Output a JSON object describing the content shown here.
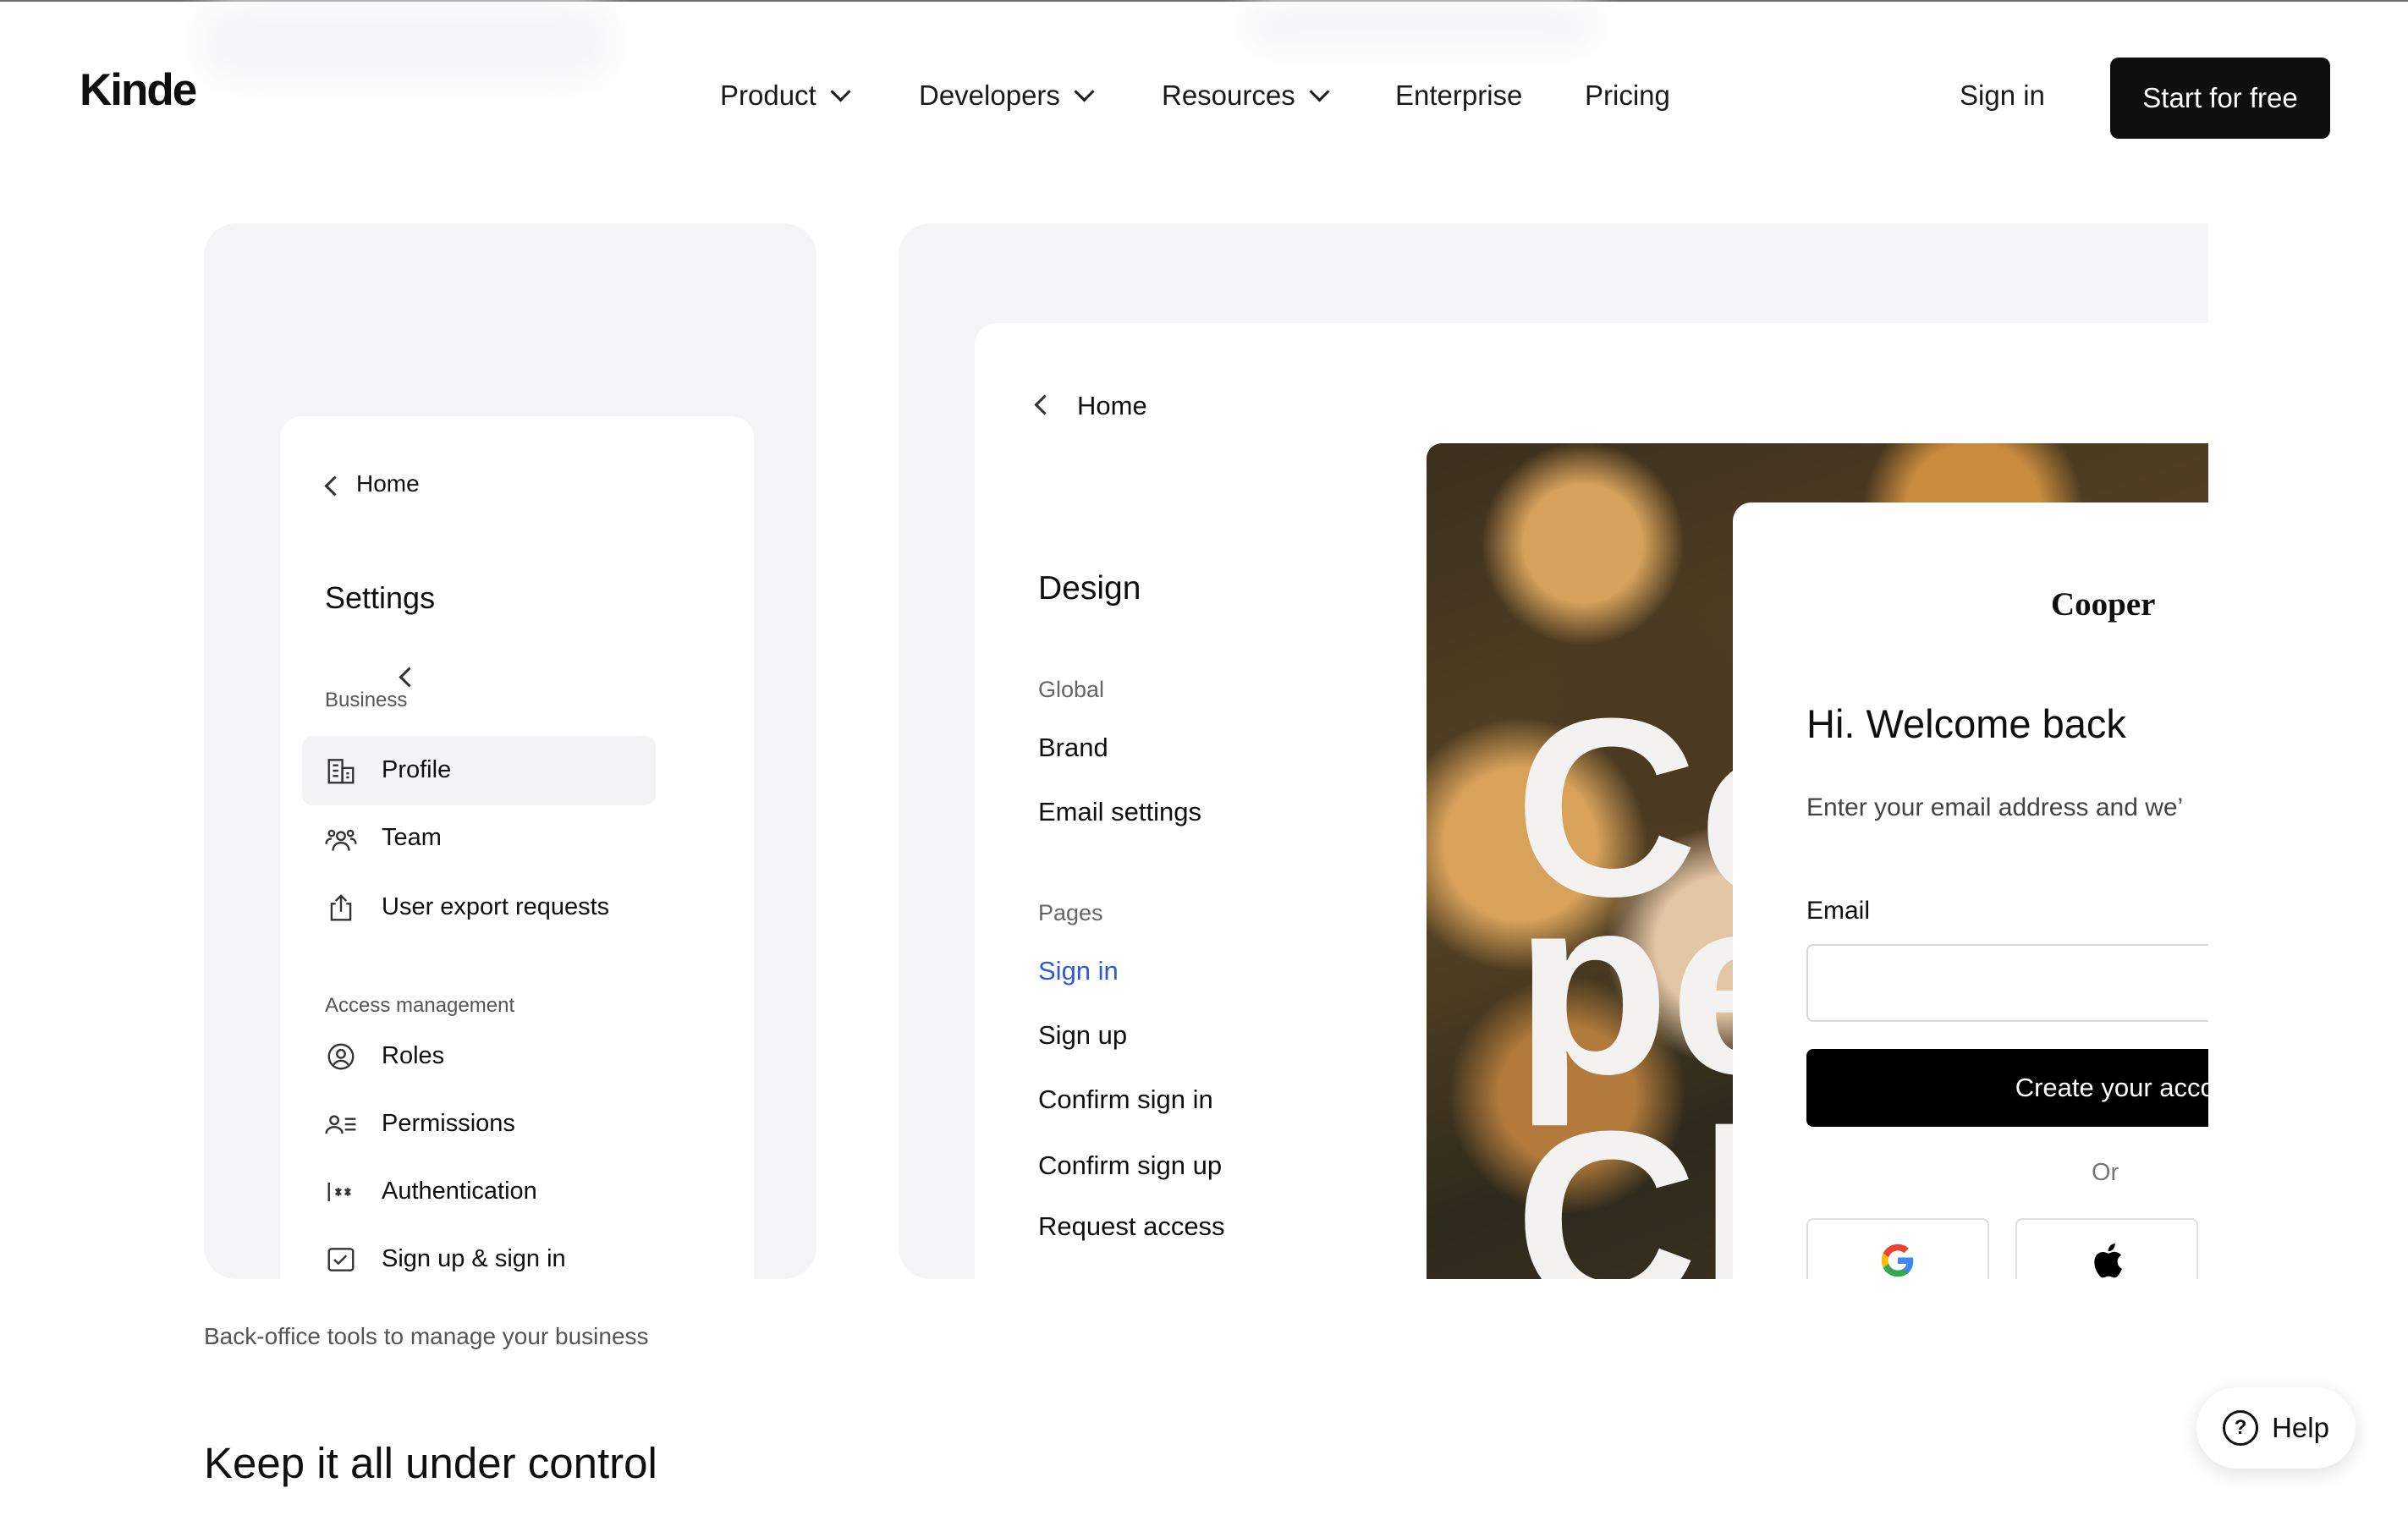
{
  "header": {
    "logo": "Kinde",
    "nav": [
      {
        "label": "Product",
        "dropdown": true
      },
      {
        "label": "Developers",
        "dropdown": true
      },
      {
        "label": "Resources",
        "dropdown": true
      },
      {
        "label": "Enterprise",
        "dropdown": false
      },
      {
        "label": "Pricing",
        "dropdown": false
      }
    ],
    "sign_in": "Sign in",
    "cta": "Start for free"
  },
  "settings_card": {
    "back": "Home",
    "title": "Settings",
    "sections": [
      {
        "heading": "Business",
        "items": [
          {
            "label": "Profile",
            "icon": "building-icon",
            "selected": true
          },
          {
            "label": "Team",
            "icon": "team-icon"
          },
          {
            "label": "User export requests",
            "icon": "export-icon"
          }
        ]
      },
      {
        "heading": "Access management",
        "items": [
          {
            "label": "Roles",
            "icon": "user-circle-icon"
          },
          {
            "label": "Permissions",
            "icon": "user-list-icon"
          },
          {
            "label": "Authentication",
            "icon": "password-icon"
          },
          {
            "label": "Sign up & sign in",
            "icon": "checkbox-icon"
          }
        ]
      }
    ],
    "caption": "Back-office tools to manage your business"
  },
  "design_card": {
    "back": "Home",
    "title": "Design",
    "global_heading": "Global",
    "global_items": [
      "Brand",
      "Email settings"
    ],
    "pages_heading": "Pages",
    "pages_items": [
      "Sign in",
      "Sign up",
      "Confirm sign in",
      "Confirm sign up",
      "Request access"
    ],
    "active_page": "Sign in",
    "preview": {
      "brand": "Cooper",
      "welcome": "Hi. Welcome back",
      "subtitle": "Enter your email address and we’",
      "email_label": "Email",
      "email_value": "",
      "create_button": "Create your accou",
      "or": "Or",
      "image_letters": [
        "Co",
        "pe",
        "Cl"
      ]
    }
  },
  "section_heading": "Keep it all under control",
  "help": "Help",
  "colors": {
    "accent_link": "#2d5ad8",
    "cta_bg": "#0f0f0f",
    "panel_bg": "#f5f5f7"
  }
}
